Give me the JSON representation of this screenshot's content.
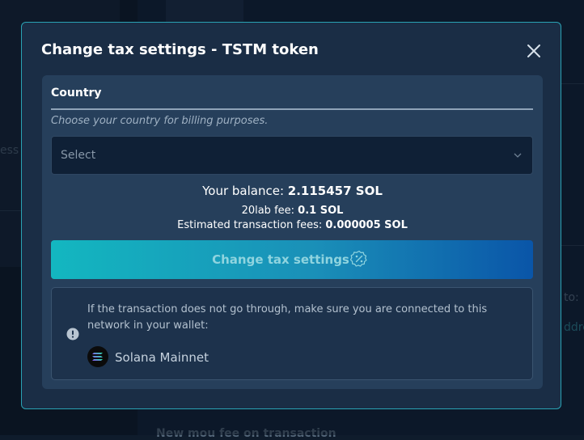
{
  "background": {
    "fragment_left": "ess",
    "fragment_right_1": "to:",
    "fragment_right_2": "ddre",
    "fragment_bottom": "New mou fee on transaction"
  },
  "modal": {
    "title": "Change tax settings - TSTM token",
    "close_icon": "close-icon"
  },
  "form": {
    "country_label": "Country",
    "country_hint": "Choose your country for billing purposes.",
    "select_placeholder": "Select"
  },
  "balance": {
    "label": "Your balance:",
    "value": "2.115457 SOL"
  },
  "fees": {
    "lab_fee_label": "20lab fee:",
    "lab_fee_value": "0.1 SOL",
    "tx_fee_label": "Estimated transaction fees:",
    "tx_fee_value": "0.000005 SOL"
  },
  "action": {
    "label": "Change tax settings",
    "icon": "percent-badge-icon"
  },
  "notice": {
    "text": "If the transaction does not go through, make sure you are connected to this network in your wallet:",
    "network_name": "Solana Mainnet",
    "icon": "info-icon"
  },
  "colors": {
    "accent": "#2aa2b4",
    "button_start": "#13b7c0",
    "button_end": "#0a55a8"
  }
}
